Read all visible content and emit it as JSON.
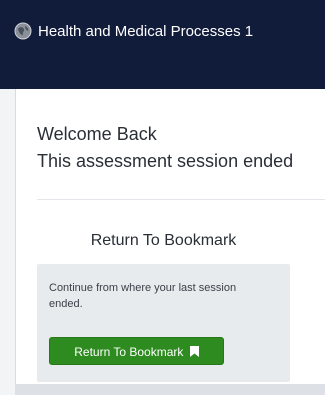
{
  "window": {
    "title": "Health and Medical Processes 1",
    "icon": "globe-icon"
  },
  "main": {
    "welcome": "Welcome Back",
    "message": "This assessment session ended",
    "bookmark_heading": "Return To Bookmark",
    "card": {
      "description": "Continue from where your last session ended.",
      "button_label": "Return To Bookmark",
      "button_icon": "bookmark-icon"
    }
  },
  "colors": {
    "titlebar": "#111b3a",
    "button": "#2e8b1f"
  }
}
